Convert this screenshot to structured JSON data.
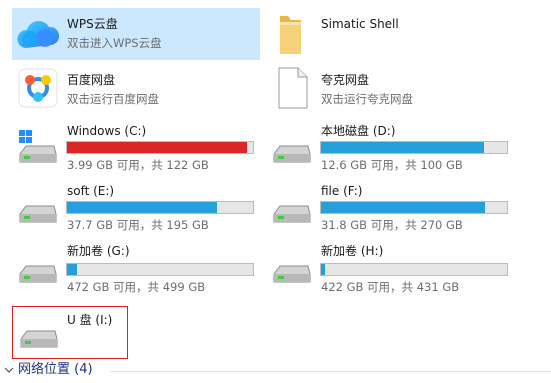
{
  "items": {
    "wps": {
      "name": "WPS云盘",
      "desc": "双击进入WPS云盘"
    },
    "simatic": {
      "name": "Simatic Shell"
    },
    "baidu": {
      "name": "百度网盘",
      "desc": "双击运行百度网盘"
    },
    "kuake": {
      "name": "夸克网盘",
      "desc": "双击运行夸克网盘"
    }
  },
  "drives": [
    {
      "name": "Windows (C:)",
      "space": "3.99 GB 可用，共 122 GB",
      "used_fraction": 0.967,
      "critical": true,
      "icon": "windows-drive-icon"
    },
    {
      "name": "本地磁盘 (D:)",
      "space": "12.6 GB 可用，共 100 GB",
      "used_fraction": 0.874,
      "critical": false,
      "icon": "drive-icon"
    },
    {
      "name": "soft (E:)",
      "space": "37.7 GB 可用，共 195 GB",
      "used_fraction": 0.807,
      "critical": false,
      "icon": "drive-icon"
    },
    {
      "name": "file (F:)",
      "space": "31.8 GB 可用，共 270 GB",
      "used_fraction": 0.882,
      "critical": false,
      "icon": "drive-icon"
    },
    {
      "name": "新加卷 (G:)",
      "space": "472 GB 可用，共 499 GB",
      "used_fraction": 0.054,
      "critical": false,
      "icon": "drive-icon"
    },
    {
      "name": "新加卷 (H:)",
      "space": "422 GB 可用，共 431 GB",
      "used_fraction": 0.021,
      "critical": false,
      "icon": "drive-icon"
    },
    {
      "name": "U 盘 (I:)",
      "icon": "usb-drive-icon"
    }
  ],
  "network_group": {
    "title": "网络位置 (4)"
  },
  "colors": {
    "selection": "#cce8ff",
    "bar_normal": "#26a0da",
    "bar_critical": "#da2626",
    "highlight_box": "#e02020",
    "group_title": "#1e3287"
  }
}
